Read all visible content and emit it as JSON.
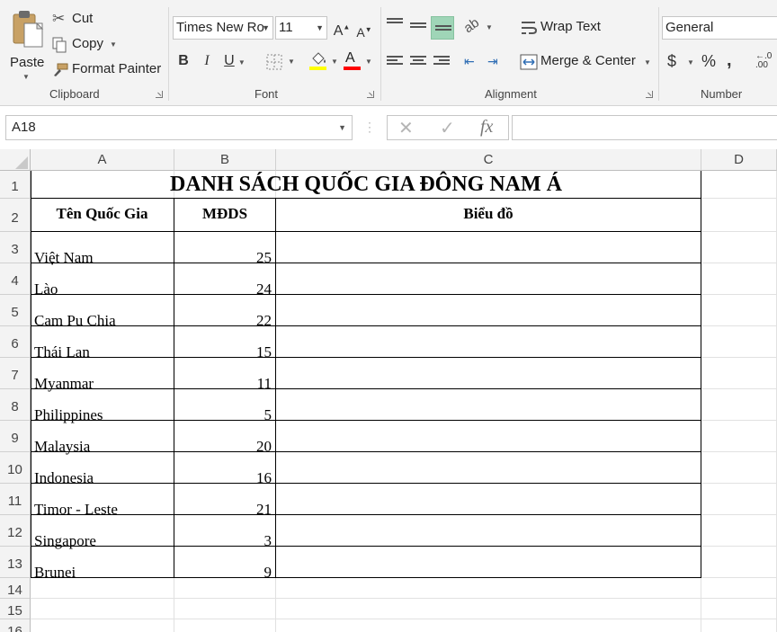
{
  "ribbon": {
    "clipboard": {
      "paste_label": "Paste",
      "cut_label": "Cut",
      "copy_label": "Copy",
      "format_painter_label": "Format Painter",
      "group_label": "Clipboard"
    },
    "font": {
      "font_name": "Times New Ro",
      "font_size": "11",
      "bold_label": "B",
      "italic_label": "I",
      "underline_label": "U",
      "font_color_letter": "A",
      "fill_color": "#ffff00",
      "font_color": "#ff0000",
      "group_label": "Font"
    },
    "alignment": {
      "wrap_text_label": "Wrap Text",
      "merge_center_label": "Merge & Center",
      "group_label": "Alignment",
      "active_color": "#9fd5b7"
    },
    "number": {
      "format_value": "General",
      "currency_symbol": "$",
      "percent_symbol": "%",
      "comma_symbol": ",",
      "group_label": "Number"
    }
  },
  "formula_bar": {
    "name_box": "A18",
    "cancel_symbol": "✕",
    "enter_symbol": "✓",
    "fx_label": "fx",
    "formula": ""
  },
  "sheet": {
    "columns": [
      "A",
      "B",
      "C",
      "D"
    ],
    "rows": [
      "1",
      "2",
      "3",
      "4",
      "5",
      "6",
      "7",
      "8",
      "9",
      "10",
      "11",
      "12",
      "13",
      "14",
      "15",
      "16"
    ],
    "title": "DANH SÁCH QUỐC GIA ĐÔNG NAM Á",
    "headers": {
      "country": "Tên Quốc Gia",
      "density": "MĐDS",
      "chart": "Biểu đồ"
    },
    "data": [
      {
        "country": "Việt Nam",
        "value": "25"
      },
      {
        "country": "Lào",
        "value": "24"
      },
      {
        "country": "Cam Pu Chia",
        "value": "22"
      },
      {
        "country": "Thái Lan",
        "value": "15"
      },
      {
        "country": "Myanmar",
        "value": "11"
      },
      {
        "country": "Philippines",
        "value": "5"
      },
      {
        "country": "Malaysia",
        "value": "20"
      },
      {
        "country": "Indonesia",
        "value": "16"
      },
      {
        "country": "Timor - Leste",
        "value": "21"
      },
      {
        "country": "Singapore",
        "value": "3"
      },
      {
        "country": "Brunei",
        "value": "9"
      }
    ]
  }
}
